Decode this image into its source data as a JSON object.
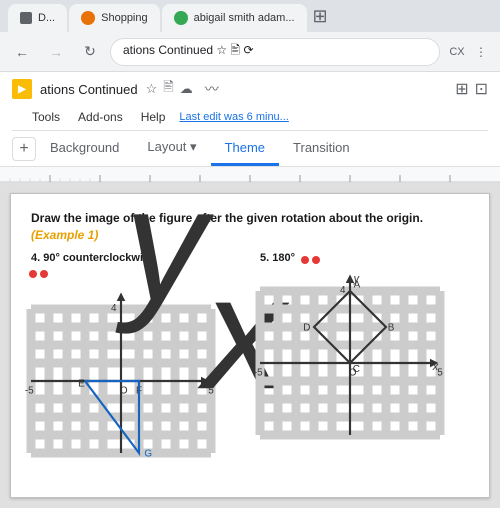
{
  "browser": {
    "tabs": [
      {
        "id": "tab1",
        "favicon_color": "#e8a000",
        "label": "D..."
      },
      {
        "id": "tab2",
        "favicon_color": "#e8710a",
        "label": "Shopping"
      },
      {
        "id": "tab3",
        "favicon_color": "#34a853",
        "label": "abigail smith adam..."
      }
    ],
    "address": "ations Continued ☆ 🖹 🔄",
    "address_text": "ations Continued ☆"
  },
  "slides": {
    "doc_title": "ations Continued",
    "last_edit": "Last edit was 6 minu...",
    "menu_items": [
      "Tools",
      "Add-ons",
      "Help"
    ],
    "toolbar_tabs": [
      {
        "id": "background",
        "label": "Background",
        "active": false
      },
      {
        "id": "layout",
        "label": "Layout ▾",
        "active": false
      },
      {
        "id": "theme",
        "label": "Theme",
        "active": true
      },
      {
        "id": "transition",
        "label": "Transition",
        "active": false
      }
    ]
  },
  "slide": {
    "title": "Draw the image of the figure after the given rotation about the origin.",
    "title_example": "(Example 1)",
    "problems": [
      {
        "id": "p4",
        "label": "4. 90° counterclockwise",
        "has_red_dots": true,
        "graph": {
          "type": "triangle",
          "points": "E,F,G",
          "E": [
            -2,
            0
          ],
          "F": [
            1,
            0
          ],
          "G": [
            1,
            -4
          ]
        }
      },
      {
        "id": "p5",
        "label": "5. 180°",
        "has_red_dots": true,
        "graph": {
          "type": "diamond",
          "points": "A,B,C,D",
          "A": [
            0,
            4
          ],
          "B": [
            2,
            2
          ],
          "C": [
            0,
            0
          ],
          "D": [
            -2,
            2
          ]
        }
      }
    ]
  }
}
